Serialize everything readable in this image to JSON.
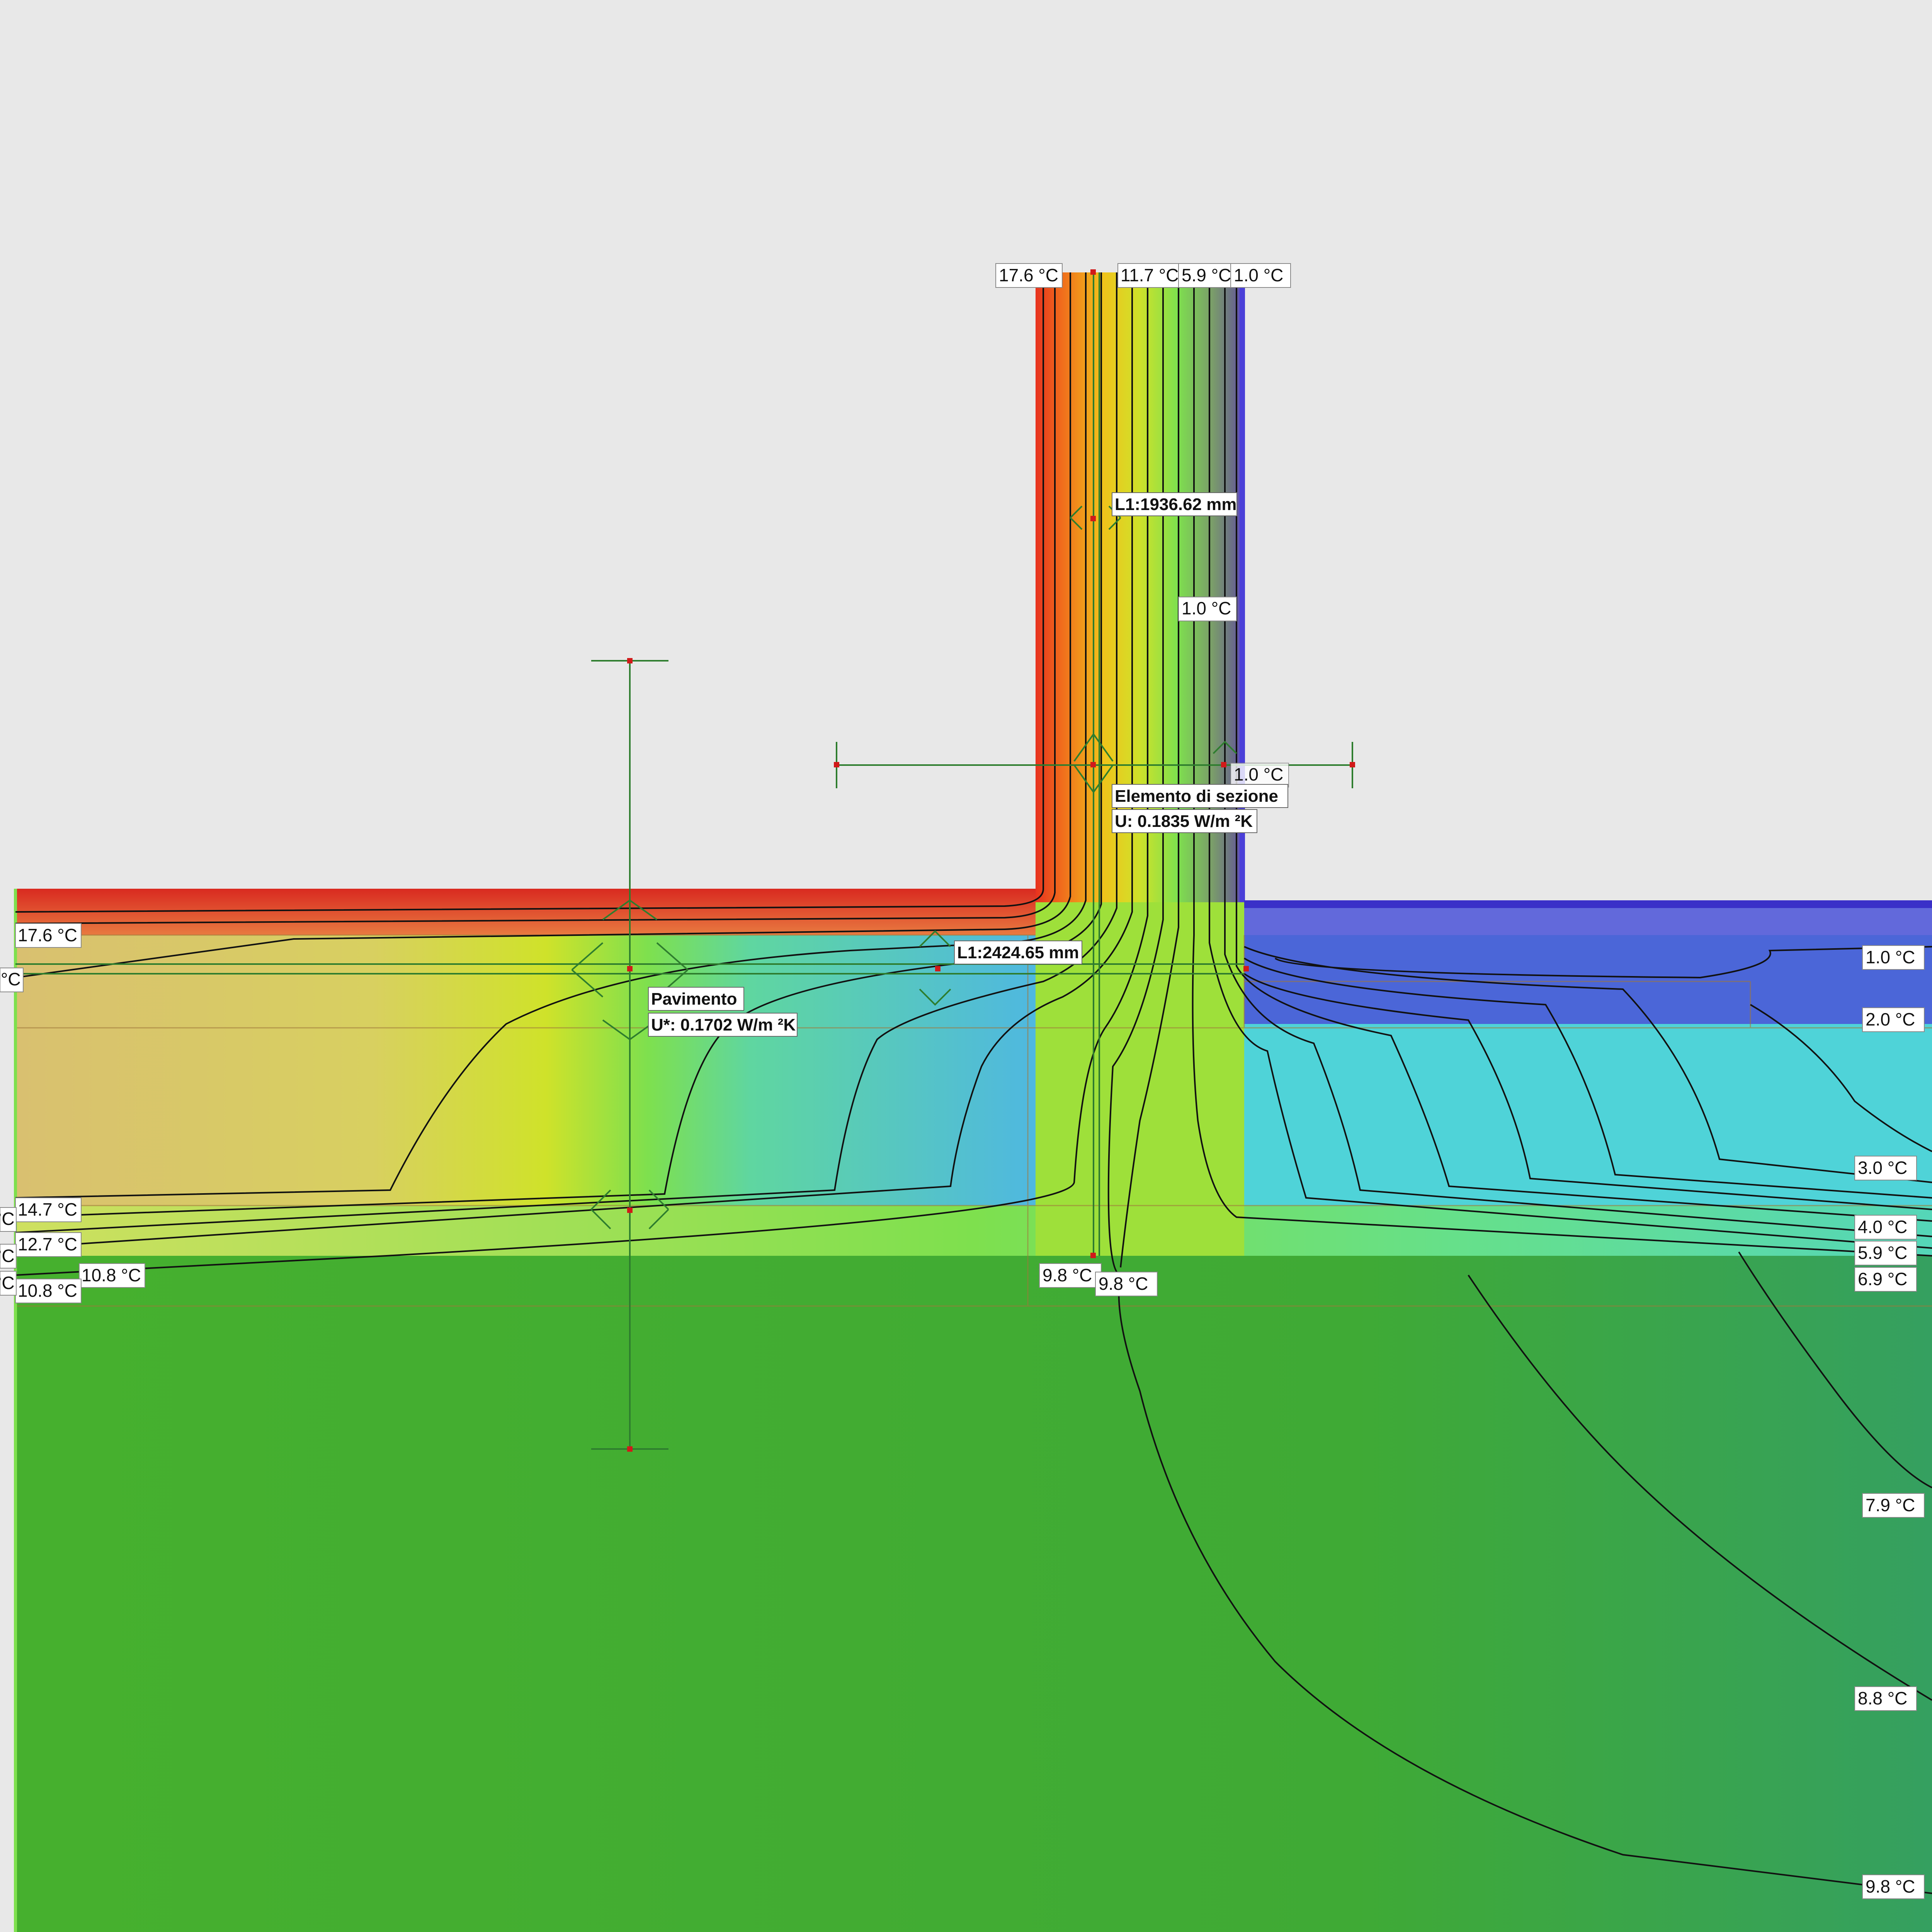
{
  "palette": {
    "hot": "#e8321e",
    "warm": "#f2c21a",
    "mid": "#7ee04e",
    "ground": "#3fae2f",
    "cold": "#4a3fd8",
    "cyan": "#4fd6d9",
    "background": "#e8e8e8",
    "isoline": "#111111",
    "annotation": "#2e7d2e",
    "marker": "#d11a1a"
  },
  "wall_top_labels": [
    "17.6  °C",
    "11.7  °C",
    "5.9  °C",
    "1.0  °C"
  ],
  "wall_labels": [
    "1.0  °C",
    "1.0  °C"
  ],
  "left_labels": [
    "17.6  °C",
    "°C",
    "14.7  °C",
    "12.7  °C",
    "10.8  °C",
    "10.8  °C",
    "°C",
    "°C",
    "°C"
  ],
  "right_labels": [
    "1.0  °C",
    "2.0  °C",
    "3.0  °C",
    "4.0  °C",
    "5.9  °C",
    "6.9  °C",
    "7.9  °C",
    "8.8  °C",
    "9.8  °C"
  ],
  "center_labels": [
    "9.8  °C",
    "9.8  °C"
  ],
  "wall_element": {
    "length": "L1:1936.62 mm",
    "name": "Elemento di sezione",
    "u_value": "U: 0.1835 W/m ²K"
  },
  "floor_element": {
    "length": "L1:2424.65 mm",
    "name": "Pavimento",
    "u_value": "U*: 0.1702 W/m ²K"
  }
}
